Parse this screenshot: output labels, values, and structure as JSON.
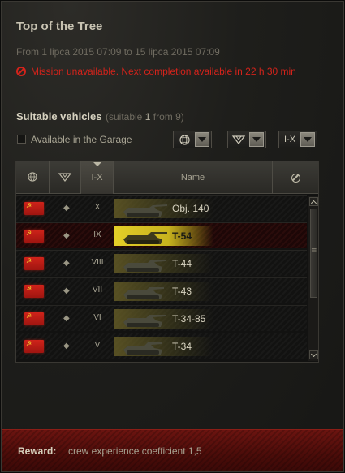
{
  "title": "Top of the Tree",
  "period": "From 1 lipca 2015 07:09 to 15 lipca 2015 07:09",
  "warning": "Mission unavailable. Next completion available in 22 h 30 min",
  "vehicles": {
    "heading": "Suitable vehicles",
    "count_prefix": "(suitable",
    "count_value": "1",
    "count_suffix": "from 9)"
  },
  "filters": {
    "garage_label": "Available in the Garage",
    "tier_filter": "I-X"
  },
  "table": {
    "tier_header": "I-X",
    "name_header": "Name",
    "rows": [
      {
        "tier": "X",
        "name": "Obj. 140",
        "selected": false
      },
      {
        "tier": "IX",
        "name": "T-54",
        "selected": true
      },
      {
        "tier": "VIII",
        "name": "T-44",
        "selected": false
      },
      {
        "tier": "VII",
        "name": "T-43",
        "selected": false
      },
      {
        "tier": "VI",
        "name": "T-34-85",
        "selected": false
      },
      {
        "tier": "V",
        "name": "T-34",
        "selected": false
      }
    ]
  },
  "reward": {
    "label": "Reward:",
    "value": "crew experience coefficient 1,5"
  },
  "colors": {
    "warning": "#d4231b",
    "selected_row": "#e5cf28",
    "reward_band": "#5a100c"
  },
  "icons": [
    "globe-icon",
    "vehicle-type-icon",
    "no-entry-icon",
    "ussr-flag-icon",
    "medium-tank-icon",
    "warning-icon"
  ]
}
